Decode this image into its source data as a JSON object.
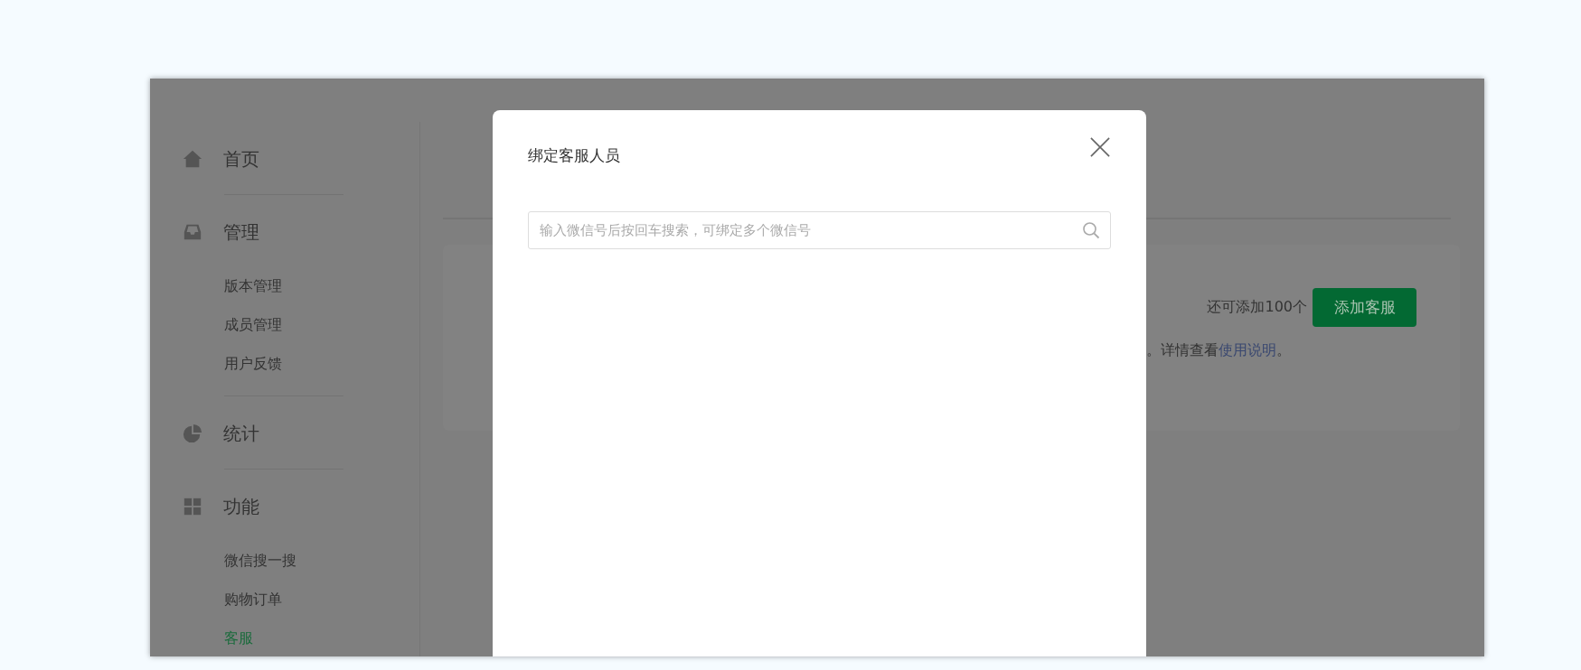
{
  "sidebar": {
    "sections": [
      {
        "label": "首页"
      },
      {
        "label": "管理",
        "items": [
          {
            "label": "版本管理",
            "selected": false
          },
          {
            "label": "成员管理",
            "selected": false
          },
          {
            "label": "用户反馈",
            "selected": false
          }
        ]
      },
      {
        "label": "统计"
      },
      {
        "label": "功能",
        "items": [
          {
            "label": "微信搜一搜",
            "selected": false
          },
          {
            "label": "购物订单",
            "selected": false
          },
          {
            "label": "客服",
            "selected": true
          }
        ]
      }
    ]
  },
  "content": {
    "remaining": "还可添加100个",
    "add_button": "添加客服",
    "note": "。详情查看",
    "note_link": "使用说明",
    "note_end": "。"
  },
  "dialog": {
    "title": "绑定客服人员",
    "search": {
      "placeholder": "输入微信号后按回车搜索，可绑定多个微信号"
    }
  }
}
